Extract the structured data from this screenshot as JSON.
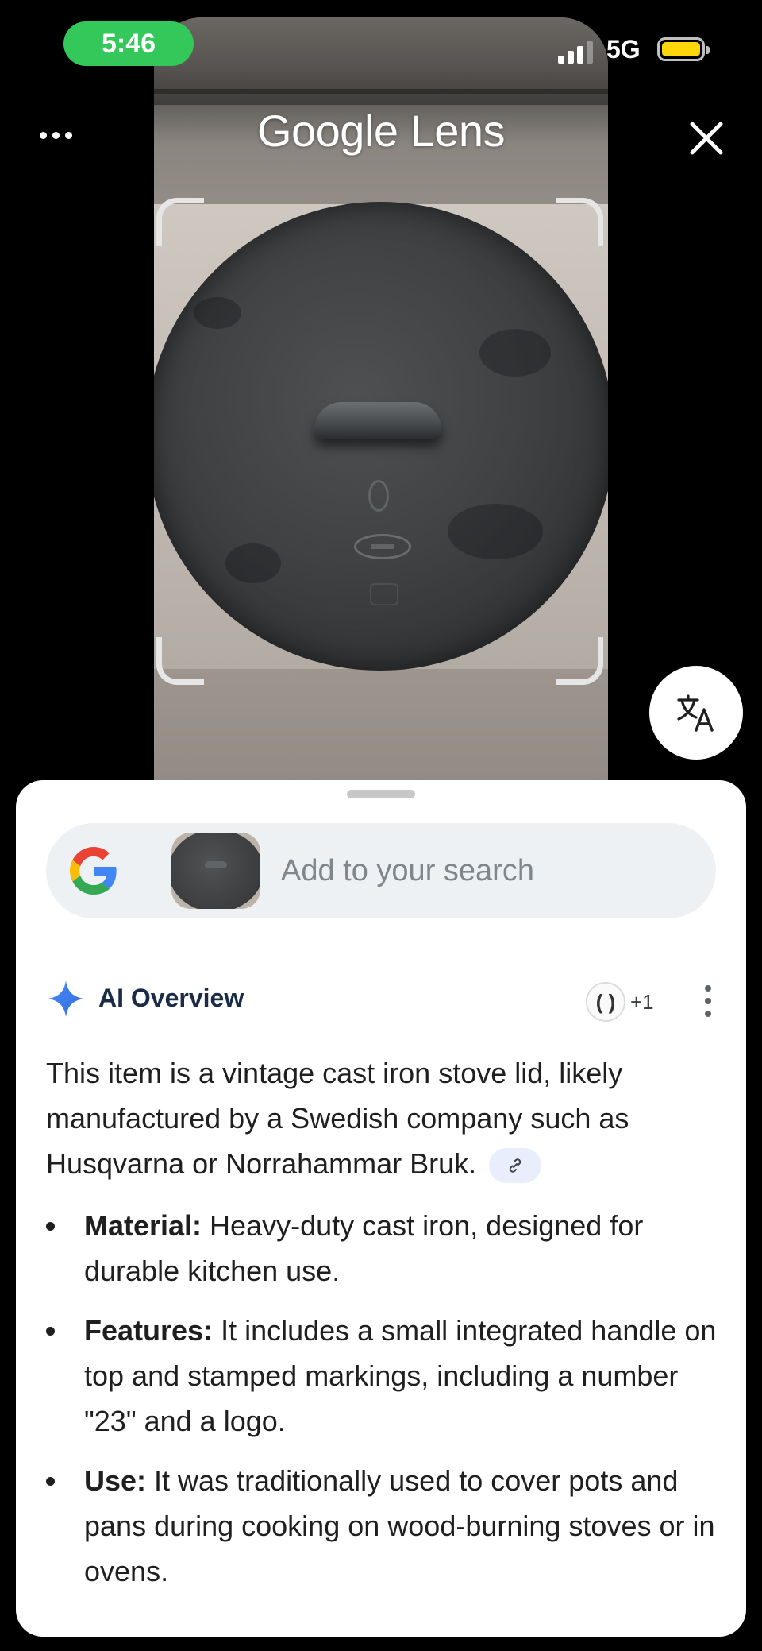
{
  "status_bar": {
    "time": "5:46",
    "network": "5G",
    "battery_color": "#ffd60a",
    "time_pill_color": "#34c759"
  },
  "header": {
    "title": "Google Lens",
    "more_icon": "more-horiz-icon",
    "close_icon": "close-icon"
  },
  "camera": {
    "translate_icon": "translate-icon"
  },
  "search": {
    "placeholder": "Add to your search",
    "logo": "google-g-icon"
  },
  "ai_overview": {
    "label": "AI Overview",
    "source_badge": "( )",
    "source_count": "+1",
    "summary": "This item is a vintage cast iron stove lid, likely manufactured by a Swedish company such as Husqvarna or Norrahammar Bruk.",
    "link_icon": "link-icon",
    "bullets": [
      {
        "term": "Material:",
        "text": " Heavy-duty cast iron, designed for durable kitchen use."
      },
      {
        "term": "Features:",
        "text": " It includes a small integrated handle on top and stamped markings, including a number \"23\" and a logo."
      },
      {
        "term": "Use:",
        "text": " It was traditionally used to cover pots and pans during cooking on wood-burning stoves or in ovens."
      }
    ]
  },
  "colors": {
    "sheet_bg": "#ffffff",
    "search_bg": "#eef1f3",
    "ai_label": "#1a2b47",
    "sparkle": "#4285f4"
  }
}
